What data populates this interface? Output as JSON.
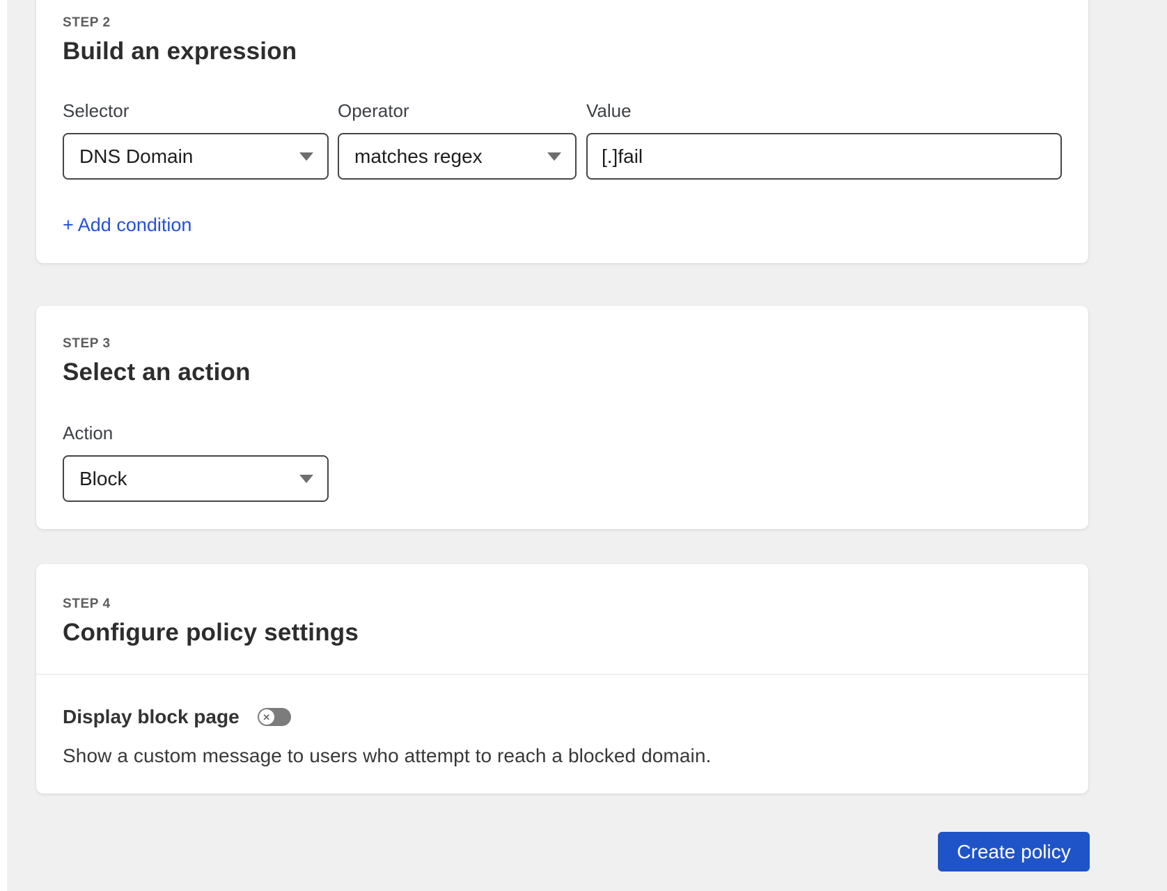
{
  "colors": {
    "page_background": "#f0f0f1",
    "card_background": "#ffffff",
    "accent_button_blue": "#1f54c9",
    "link_blue": "#2352d8",
    "toggle_off_gray": "#7c7c7c",
    "field_border": "#464646"
  },
  "icons": {
    "chevron_down": "dropdown triangle",
    "toggle_off_glyph": "✕"
  },
  "steps": [
    {
      "step_label": "STEP 2",
      "title": "Build an expression",
      "fields": [
        {
          "label": "Selector",
          "value": "DNS Domain",
          "type": "select"
        },
        {
          "label": "Operator",
          "value": "matches regex",
          "type": "select"
        },
        {
          "label": "Value",
          "value": "[.]fail",
          "type": "input"
        }
      ],
      "add_condition_label": "+ Add condition"
    },
    {
      "step_label": "STEP 3",
      "title": "Select an action",
      "fields": [
        {
          "label": "Action",
          "value": "Block",
          "type": "select"
        }
      ]
    },
    {
      "step_label": "STEP 4",
      "title": "Configure policy settings",
      "toggle": {
        "label": "Display block page",
        "state": "off"
      },
      "description": "Show a custom message to users who attempt to reach a blocked domain."
    }
  ],
  "footer": {
    "create_button_label": "Create policy"
  }
}
